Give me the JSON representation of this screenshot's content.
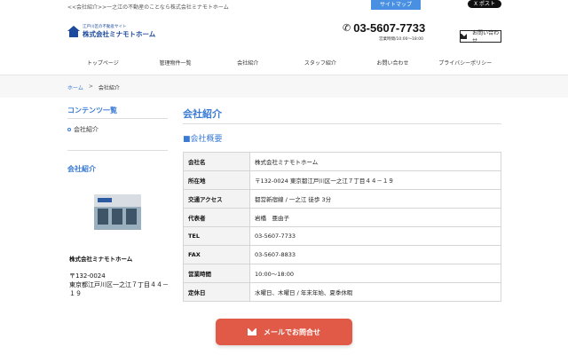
{
  "header": {
    "tagline": "<<会社紹介>>一之江の不動産のことなら株式会社ミナモトホーム",
    "sitemap_label": "サイトマップ",
    "x_post_label": "X ポスト",
    "logo_sub": "江戸川区の不動産サイト",
    "logo_main": "株式会社ミナモトホーム",
    "phone": "03-5607-7733",
    "hours": "営業時間/10:00〜18:00",
    "contact_label": "お問い合わせ"
  },
  "nav": {
    "items": [
      "トップページ",
      "管理物件一覧",
      "会社紹介",
      "スタッフ紹介",
      "お問い合わせ",
      "プライバシーポリシー"
    ]
  },
  "breadcrumb": {
    "home": "ホーム",
    "sep": ">",
    "current": "会社紹介"
  },
  "sidebar": {
    "contents_title": "コンテンツ一覧",
    "link": "会社紹介",
    "company_title": "会社紹介",
    "company_name": "株式会社ミナモトホーム",
    "postal": "〒132-0024",
    "address": "東京都江戸川区一之江７丁目４４－１９"
  },
  "main": {
    "title": "会社紹介",
    "section": "■会社概要",
    "rows": [
      {
        "key": "会社名",
        "value": "株式会社ミナモトホーム"
      },
      {
        "key": "所在地",
        "value": "〒132-0024 東京都江戸川区一之江７丁目４４－１９"
      },
      {
        "key": "交通アクセス",
        "value": "都営新宿線 / 一之江 徒歩 3分"
      },
      {
        "key": "代表者",
        "value": "岩橋　亜由子"
      },
      {
        "key": "TEL",
        "value": "03-5607-7733"
      },
      {
        "key": "FAX",
        "value": "03-5607-8833"
      },
      {
        "key": "営業時間",
        "value": "10:00〜18:00"
      },
      {
        "key": "定休日",
        "value": "水曜日、木曜日 / 年末年始、夏季休暇"
      }
    ]
  },
  "floating": {
    "mail_label": "メールでお問合せ"
  },
  "colors": {
    "accent": "#3a7bd5",
    "logo": "#1d4a9c",
    "cta": "#e05a47"
  }
}
